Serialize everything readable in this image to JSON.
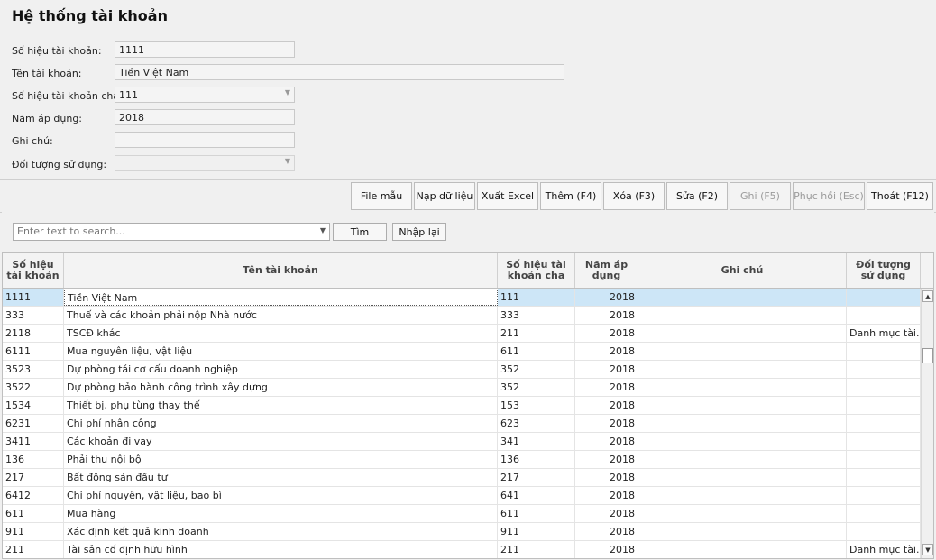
{
  "window": {
    "title": "Hệ thống tài khoản"
  },
  "form": {
    "account_number_label": "Số hiệu tài khoản:",
    "account_number_value": "1111",
    "account_name_label": "Tên tài khoản:",
    "account_name_value": "Tiền Việt Nam",
    "parent_account_label": "Số hiệu tài khoản cha:",
    "parent_account_value": "111",
    "year_label": "Năm áp dụng:",
    "year_value": "2018",
    "note_label": "Ghi chú:",
    "note_value": "",
    "usage_object_label": "Đối tượng sử dụng:",
    "usage_object_value": ""
  },
  "toolbar": {
    "file_template": "File mẫu",
    "load_data": "Nạp dữ liệu",
    "export_excel": "Xuất Excel",
    "add": "Thêm (F4)",
    "delete": "Xóa (F3)",
    "edit": "Sửa (F2)",
    "save": "Ghi (F5)",
    "restore": "Phục hồi (Esc)",
    "exit": "Thoát (F12)"
  },
  "search": {
    "placeholder": "Enter text to search...",
    "find_button": "Tìm",
    "reset_button": "Nhập lại"
  },
  "grid": {
    "columns": {
      "account_number": "Số hiệu tài khoản",
      "account_name": "Tên tài khoản",
      "parent_account": "Số hiệu tài khoản cha",
      "year": "Năm áp dụng",
      "note": "Ghi chú",
      "usage_object": "Đối tượng sử dụng"
    },
    "rows": [
      [
        "1111",
        "Tiền Việt Nam",
        "111",
        "2018",
        "",
        ""
      ],
      [
        "333",
        "Thuế và các khoản phải nộp Nhà nước",
        "333",
        "2018",
        "",
        ""
      ],
      [
        "2118",
        "TSCĐ khác",
        "211",
        "2018",
        "",
        "Danh mục tài..."
      ],
      [
        "6111",
        "Mua nguyên liệu, vật liệu",
        "611",
        "2018",
        "",
        ""
      ],
      [
        "3523",
        "Dự phòng tái cơ cấu doanh nghiệp",
        "352",
        "2018",
        "",
        ""
      ],
      [
        "3522",
        "Dự phòng bảo hành công trình xây dựng",
        "352",
        "2018",
        "",
        ""
      ],
      [
        "1534",
        "Thiết bị, phụ tùng thay thế",
        "153",
        "2018",
        "",
        ""
      ],
      [
        "6231",
        "Chi phí nhân công",
        "623",
        "2018",
        "",
        ""
      ],
      [
        "3411",
        "Các khoản đi vay",
        "341",
        "2018",
        "",
        ""
      ],
      [
        "136",
        "Phải thu nội bộ",
        "136",
        "2018",
        "",
        ""
      ],
      [
        "217",
        "Bất động sản đầu tư",
        "217",
        "2018",
        "",
        ""
      ],
      [
        "6412",
        "Chi phí nguyên, vật liệu, bao bì",
        "641",
        "2018",
        "",
        ""
      ],
      [
        "611",
        "Mua hàng",
        "611",
        "2018",
        "",
        ""
      ],
      [
        "911",
        "Xác định kết quả kinh doanh",
        "911",
        "2018",
        "",
        ""
      ],
      [
        "211",
        "Tài sản cố định hữu hình",
        "211",
        "2018",
        "",
        "Danh mục tài..."
      ]
    ],
    "selected_row": 0
  },
  "icons": {
    "dropdown": "chevron-down-icon",
    "scroll_up": "arrow-up-icon",
    "scroll_down": "arrow-down-icon"
  },
  "colors": {
    "selected_row": "#cde6f7",
    "background": "#f0f0f0"
  }
}
